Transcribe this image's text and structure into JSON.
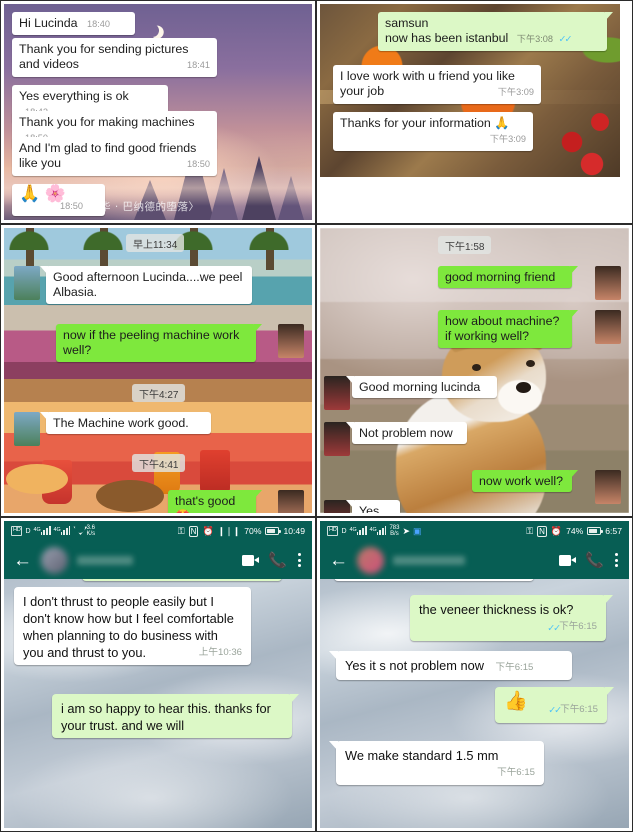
{
  "panels": [
    {
      "id": "p1",
      "name": "chat-night-wallpaper",
      "background_caption": "华 · 巴纳德的堕落〉",
      "messages": [
        {
          "side": "in",
          "text": "Hi Lucinda",
          "time": "18:40"
        },
        {
          "side": "in",
          "text": "Thank you for sending pictures and videos",
          "time": "18:41"
        },
        {
          "side": "in",
          "text": "Yes everything is ok",
          "time": "18:42"
        },
        {
          "side": "in",
          "text": "Thank you for making machines",
          "time": "18:50"
        },
        {
          "side": "in",
          "text": "And I'm glad to find good friends like you",
          "time": "18:50"
        },
        {
          "side": "in",
          "text": "🙏 🌸",
          "time": "18:50"
        }
      ]
    },
    {
      "id": "p2",
      "name": "chat-food-wallpaper",
      "messages": [
        {
          "side": "out",
          "text": "samsun\nnow has been istanbul",
          "time": "下午3:08",
          "ticks": "✓✓"
        },
        {
          "side": "in",
          "text": "I love work with u friend you like your job",
          "time": "下午3:09"
        },
        {
          "side": "in",
          "text": "Thanks for your information 🙏",
          "time": "下午3:09"
        }
      ]
    },
    {
      "id": "p3",
      "name": "chat-pool-wallpaper",
      "daystamps": [
        "早上11:34",
        "下午4:27",
        "下午4:41"
      ],
      "messages": [
        {
          "side": "in",
          "text": "Good afternoon Lucinda....we peel Albasia."
        },
        {
          "side": "out",
          "text": "now if the peeling machine work well?"
        },
        {
          "side": "in",
          "text": "The Machine work good."
        },
        {
          "side": "out",
          "text": "that's good 🤩"
        }
      ]
    },
    {
      "id": "p4",
      "name": "chat-dog-wallpaper",
      "daystamps": [
        "下午1:58"
      ],
      "messages": [
        {
          "side": "out",
          "text": "good morning friend"
        },
        {
          "side": "out",
          "text": "how about machine?\nif working well?"
        },
        {
          "side": "in",
          "text": "Good morning lucinda"
        },
        {
          "side": "in",
          "text": "Not problem now"
        },
        {
          "side": "out",
          "text": "now work well?"
        },
        {
          "side": "in",
          "text": "Yes"
        }
      ]
    },
    {
      "id": "p5",
      "name": "whatsapp-screenshot-trust",
      "statusbar": {
        "hd": "HD",
        "data_label": "D",
        "net1": "4G",
        "net2": "4G",
        "speed_value": "3.6",
        "speed_unit": "K/s",
        "battery": "70%",
        "clock": "10:49"
      },
      "messages": [
        {
          "side": "in",
          "text": "I don't thrust to people easily but I  don't know how but I feel comfortable when planning to do business with you and thrust to you.",
          "time": "上午10:36"
        },
        {
          "side": "out",
          "text": "i am so happy to hear this. thanks for your trust. and we will"
        }
      ]
    },
    {
      "id": "p6",
      "name": "whatsapp-screenshot-veneer",
      "statusbar": {
        "hd": "HD",
        "data_label": "D",
        "net1": "4G",
        "net2": "4G",
        "speed_value": "783",
        "speed_unit": "B/s",
        "battery": "74%",
        "clock": "6:57"
      },
      "messages": [
        {
          "side": "out",
          "text": "the veneer thickness is ok?",
          "time": "下午6:15",
          "ticks": "✓✓"
        },
        {
          "side": "in",
          "text": "Yes it s not problem now",
          "time": "下午6:15"
        },
        {
          "side": "out",
          "text": "👍",
          "time": "下午6:15",
          "ticks": "✓✓"
        },
        {
          "side": "in",
          "text": "We make standard 1.5 mm",
          "time": "下午6:15"
        }
      ]
    }
  ],
  "colors": {
    "bubble_in": "#ffffff",
    "bubble_out_pale": "#dcf8c6",
    "bubble_out_lime": "#7ee83d",
    "whatsapp_header": "#075e54",
    "tick_blue": "#4fc3f7"
  }
}
